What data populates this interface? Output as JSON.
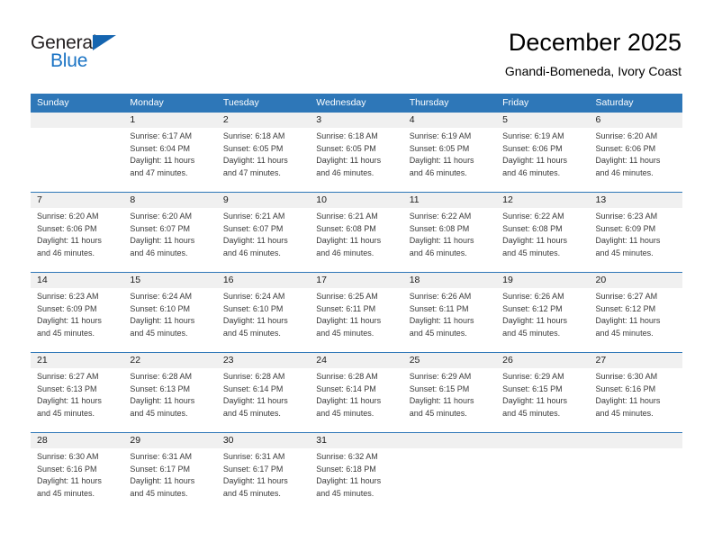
{
  "brand": {
    "name_part1": "General",
    "name_part2": "Blue",
    "color_dark": "#231f20",
    "color_blue": "#1a73c4"
  },
  "header": {
    "title": "December 2025",
    "subtitle": "Gnandi-Bomeneda, Ivory Coast"
  },
  "theme": {
    "header_blue": "#2e77b8",
    "band_gray": "#f0f0f0"
  },
  "weekdays": [
    "Sunday",
    "Monday",
    "Tuesday",
    "Wednesday",
    "Thursday",
    "Friday",
    "Saturday"
  ],
  "weeks": [
    [
      {
        "num": "",
        "info": ""
      },
      {
        "num": "1",
        "info": "Sunrise: 6:17 AM\nSunset: 6:04 PM\nDaylight: 11 hours\nand 47 minutes."
      },
      {
        "num": "2",
        "info": "Sunrise: 6:18 AM\nSunset: 6:05 PM\nDaylight: 11 hours\nand 47 minutes."
      },
      {
        "num": "3",
        "info": "Sunrise: 6:18 AM\nSunset: 6:05 PM\nDaylight: 11 hours\nand 46 minutes."
      },
      {
        "num": "4",
        "info": "Sunrise: 6:19 AM\nSunset: 6:05 PM\nDaylight: 11 hours\nand 46 minutes."
      },
      {
        "num": "5",
        "info": "Sunrise: 6:19 AM\nSunset: 6:06 PM\nDaylight: 11 hours\nand 46 minutes."
      },
      {
        "num": "6",
        "info": "Sunrise: 6:20 AM\nSunset: 6:06 PM\nDaylight: 11 hours\nand 46 minutes."
      }
    ],
    [
      {
        "num": "7",
        "info": "Sunrise: 6:20 AM\nSunset: 6:06 PM\nDaylight: 11 hours\nand 46 minutes."
      },
      {
        "num": "8",
        "info": "Sunrise: 6:20 AM\nSunset: 6:07 PM\nDaylight: 11 hours\nand 46 minutes."
      },
      {
        "num": "9",
        "info": "Sunrise: 6:21 AM\nSunset: 6:07 PM\nDaylight: 11 hours\nand 46 minutes."
      },
      {
        "num": "10",
        "info": "Sunrise: 6:21 AM\nSunset: 6:08 PM\nDaylight: 11 hours\nand 46 minutes."
      },
      {
        "num": "11",
        "info": "Sunrise: 6:22 AM\nSunset: 6:08 PM\nDaylight: 11 hours\nand 46 minutes."
      },
      {
        "num": "12",
        "info": "Sunrise: 6:22 AM\nSunset: 6:08 PM\nDaylight: 11 hours\nand 45 minutes."
      },
      {
        "num": "13",
        "info": "Sunrise: 6:23 AM\nSunset: 6:09 PM\nDaylight: 11 hours\nand 45 minutes."
      }
    ],
    [
      {
        "num": "14",
        "info": "Sunrise: 6:23 AM\nSunset: 6:09 PM\nDaylight: 11 hours\nand 45 minutes."
      },
      {
        "num": "15",
        "info": "Sunrise: 6:24 AM\nSunset: 6:10 PM\nDaylight: 11 hours\nand 45 minutes."
      },
      {
        "num": "16",
        "info": "Sunrise: 6:24 AM\nSunset: 6:10 PM\nDaylight: 11 hours\nand 45 minutes."
      },
      {
        "num": "17",
        "info": "Sunrise: 6:25 AM\nSunset: 6:11 PM\nDaylight: 11 hours\nand 45 minutes."
      },
      {
        "num": "18",
        "info": "Sunrise: 6:26 AM\nSunset: 6:11 PM\nDaylight: 11 hours\nand 45 minutes."
      },
      {
        "num": "19",
        "info": "Sunrise: 6:26 AM\nSunset: 6:12 PM\nDaylight: 11 hours\nand 45 minutes."
      },
      {
        "num": "20",
        "info": "Sunrise: 6:27 AM\nSunset: 6:12 PM\nDaylight: 11 hours\nand 45 minutes."
      }
    ],
    [
      {
        "num": "21",
        "info": "Sunrise: 6:27 AM\nSunset: 6:13 PM\nDaylight: 11 hours\nand 45 minutes."
      },
      {
        "num": "22",
        "info": "Sunrise: 6:28 AM\nSunset: 6:13 PM\nDaylight: 11 hours\nand 45 minutes."
      },
      {
        "num": "23",
        "info": "Sunrise: 6:28 AM\nSunset: 6:14 PM\nDaylight: 11 hours\nand 45 minutes."
      },
      {
        "num": "24",
        "info": "Sunrise: 6:28 AM\nSunset: 6:14 PM\nDaylight: 11 hours\nand 45 minutes."
      },
      {
        "num": "25",
        "info": "Sunrise: 6:29 AM\nSunset: 6:15 PM\nDaylight: 11 hours\nand 45 minutes."
      },
      {
        "num": "26",
        "info": "Sunrise: 6:29 AM\nSunset: 6:15 PM\nDaylight: 11 hours\nand 45 minutes."
      },
      {
        "num": "27",
        "info": "Sunrise: 6:30 AM\nSunset: 6:16 PM\nDaylight: 11 hours\nand 45 minutes."
      }
    ],
    [
      {
        "num": "28",
        "info": "Sunrise: 6:30 AM\nSunset: 6:16 PM\nDaylight: 11 hours\nand 45 minutes."
      },
      {
        "num": "29",
        "info": "Sunrise: 6:31 AM\nSunset: 6:17 PM\nDaylight: 11 hours\nand 45 minutes."
      },
      {
        "num": "30",
        "info": "Sunrise: 6:31 AM\nSunset: 6:17 PM\nDaylight: 11 hours\nand 45 minutes."
      },
      {
        "num": "31",
        "info": "Sunrise: 6:32 AM\nSunset: 6:18 PM\nDaylight: 11 hours\nand 45 minutes."
      },
      {
        "num": "",
        "info": ""
      },
      {
        "num": "",
        "info": ""
      },
      {
        "num": "",
        "info": ""
      }
    ]
  ]
}
